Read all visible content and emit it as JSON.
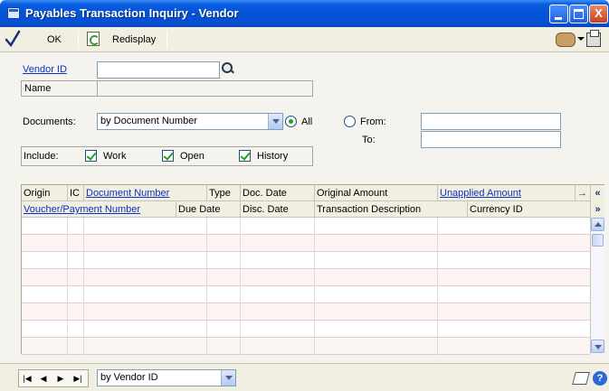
{
  "window": {
    "title": "Payables Transaction Inquiry - Vendor",
    "controls": {
      "minimize": "",
      "maximize": "",
      "close": "X"
    }
  },
  "toolbar": {
    "ok_label": "OK",
    "redisplay_label": "Redisplay"
  },
  "form": {
    "vendor_id_label": "Vendor ID",
    "vendor_id_value": "",
    "name_label": "Name",
    "name_value": "",
    "documents_label": "Documents:",
    "documents_value": "by Document Number",
    "all_label": "All",
    "all_selected": true,
    "from_label": "From:",
    "from_value": "",
    "to_label": "To:",
    "to_value": "",
    "include_label": "Include:",
    "include": [
      {
        "label": "Work",
        "checked": true
      },
      {
        "label": "Open",
        "checked": true
      },
      {
        "label": "History",
        "checked": true
      }
    ]
  },
  "grid": {
    "header1": [
      "Origin",
      "IC",
      "Document Number",
      "Type",
      "Doc. Date",
      "Original Amount",
      "Unapplied Amount"
    ],
    "header2": [
      "Voucher/Payment Number",
      "Due Date",
      "Disc. Date",
      "Transaction Description",
      "Currency ID"
    ],
    "header1_side": "→",
    "header1_collapse": "«",
    "header2_expand": "»",
    "row_count": 8
  },
  "bottom": {
    "nav": [
      "|◀",
      "◀",
      "▶",
      "▶|"
    ],
    "sort_value": "by Vendor ID",
    "help": "?"
  },
  "colors": {
    "title_bar": "#0452d6",
    "link": "#0b31c8",
    "check_green": "#21a121"
  }
}
